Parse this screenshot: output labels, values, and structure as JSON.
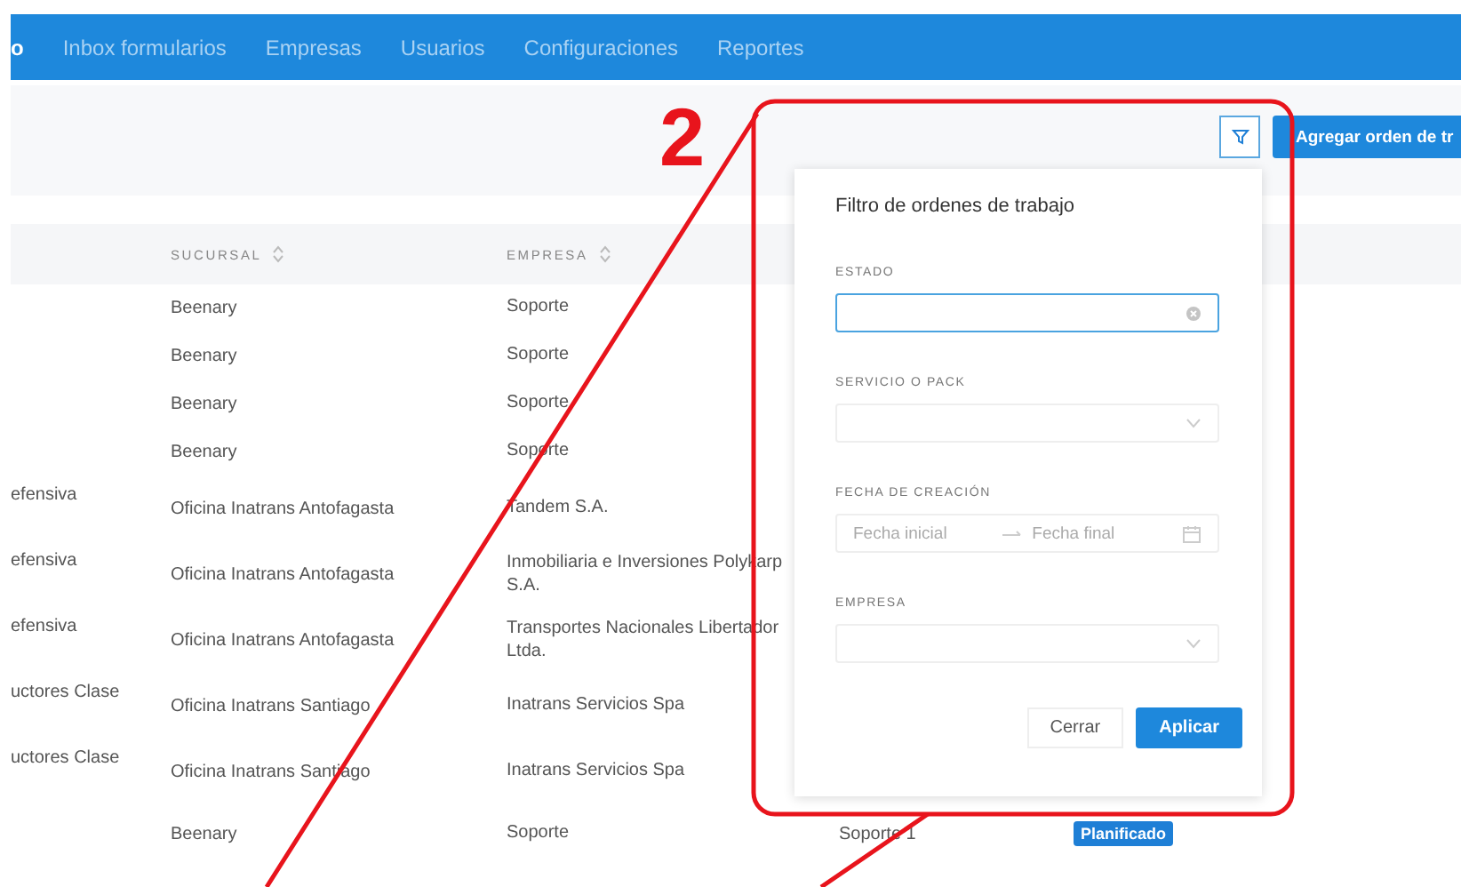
{
  "nav": {
    "items": [
      {
        "label": "o",
        "selected": true
      },
      {
        "label": "Inbox formularios",
        "selected": false
      },
      {
        "label": "Empresas",
        "selected": false
      },
      {
        "label": "Usuarios",
        "selected": false
      },
      {
        "label": "Configuraciones",
        "selected": false
      },
      {
        "label": "Reportes",
        "selected": false
      }
    ]
  },
  "toolbar": {
    "add_button": "Agregar orden de tr"
  },
  "table": {
    "columns": [
      {
        "label": "SUCURSAL"
      },
      {
        "label": "EMPRESA"
      }
    ],
    "rows": [
      {
        "sucursal": "Beenary",
        "empresa": "Soporte"
      },
      {
        "sucursal": "Beenary",
        "empresa": "Soporte"
      },
      {
        "sucursal": "Beenary",
        "empresa": "Soporte"
      },
      {
        "sucursal": "Beenary",
        "empresa": "Soporte"
      },
      {
        "column_1": "efensiva",
        "sucursal": "Oficina Inatrans Antofagasta",
        "empresa": "Tandem S.A."
      },
      {
        "column_1": "efensiva",
        "sucursal": "Oficina Inatrans Antofagasta",
        "empresa": "Inmobiliaria e Inversiones Polykarp S.A."
      },
      {
        "column_1": "efensiva",
        "sucursal": "Oficina Inatrans Antofagasta",
        "empresa": "Transportes Nacionales Libertador Ltda."
      },
      {
        "column_1": "uctores Clase",
        "sucursal": "Oficina Inatrans Santiago",
        "empresa": "Inatrans Servicios Spa"
      },
      {
        "column_1": "uctores Clase",
        "sucursal": "Oficina Inatrans Santiago",
        "empresa": "Inatrans Servicios Spa"
      },
      {
        "sucursal": "Beenary",
        "empresa": "Soporte",
        "column_4": "Soporte 1",
        "status": {
          "label": "Planificado",
          "color": "#1e7fd6"
        }
      }
    ]
  },
  "filter_popup": {
    "title": "Filtro de ordenes de trabajo",
    "fields": [
      {
        "label": "ESTADO",
        "kind": "clearable",
        "focused": true
      },
      {
        "label": "SERVICIO O PACK",
        "kind": "select",
        "focused": false
      },
      {
        "label": "FECHA DE CREACIÓN",
        "kind": "daterange",
        "focused": false,
        "start_placeholder": "Fecha inicial",
        "end_placeholder": "Fecha final"
      },
      {
        "label": "EMPRESA",
        "kind": "select",
        "focused": false
      }
    ],
    "cancel_button": "Cerrar",
    "apply_button": "Aplicar"
  },
  "annotation": {
    "number": "2"
  }
}
